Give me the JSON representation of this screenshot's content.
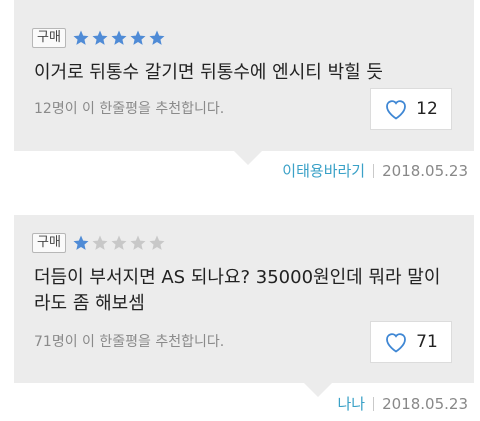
{
  "reviews": [
    {
      "badge": "구매",
      "rating": 5,
      "text": "이거로 뒤통수 갈기면 뒤통수에 엔시티 박힐 듯",
      "recommend_text": "12명이 이 한줄평을 추천합니다.",
      "likes": "12",
      "author": "이태용바라기",
      "date": "2018.05.23"
    },
    {
      "badge": "구매",
      "rating": 1,
      "text": "더듬이 부서지면 AS 되나요? 35000원인데 뭐라 말이 라도 좀 해보셈",
      "recommend_text": "71명이 이 한줄평을 추천합니다.",
      "likes": "71",
      "author": "나나",
      "date": "2018.05.23"
    }
  ],
  "colors": {
    "star_filled": "#4f8bd6",
    "star_empty": "#c8c8c8",
    "author": "#3aa1c7",
    "heart": "#3f87d4"
  },
  "icons": [
    "star-icon",
    "heart-icon"
  ]
}
